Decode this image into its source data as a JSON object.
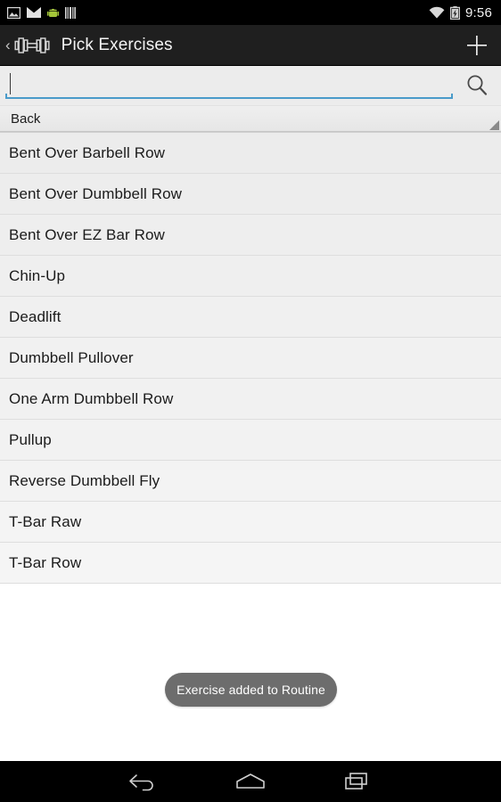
{
  "status_bar": {
    "icons": [
      "screenshot-icon",
      "email-icon",
      "android-icon",
      "barcode-icon"
    ],
    "wifi_icon": "wifi-icon",
    "battery_icon": "battery-charging-icon",
    "clock": "9:56",
    "background": "#000000"
  },
  "action_bar": {
    "back_chevron": "‹",
    "app_icon": "dumbbell-icon",
    "title": "Pick Exercises",
    "add_label": "+",
    "background": "#1f1f1f",
    "title_color": "#f4f4f4"
  },
  "search": {
    "value": "",
    "placeholder": "",
    "icon": "search-icon",
    "accent_color": "#4a9bca"
  },
  "spinner": {
    "selected": "Back",
    "options": [
      "Back"
    ],
    "caret_icon": "dropdown-caret-icon"
  },
  "list": {
    "items": [
      {
        "label": "Bent Over Barbell Row"
      },
      {
        "label": "Bent Over Dumbbell Row"
      },
      {
        "label": "Bent Over EZ Bar Row"
      },
      {
        "label": "Chin-Up"
      },
      {
        "label": "Deadlift"
      },
      {
        "label": "Dumbbell Pullover"
      },
      {
        "label": "One Arm Dumbbell Row"
      },
      {
        "label": "Pullup"
      },
      {
        "label": "Reverse Dumbbell Fly"
      },
      {
        "label": "T-Bar Raw"
      },
      {
        "label": "T-Bar Row"
      }
    ]
  },
  "toast": {
    "message": "Exercise added to Routine",
    "background": "#6d6d6d",
    "text_color": "#ffffff"
  },
  "nav_bar": {
    "back": "back-icon",
    "home": "home-icon",
    "recents": "recents-icon",
    "background": "#000000"
  }
}
